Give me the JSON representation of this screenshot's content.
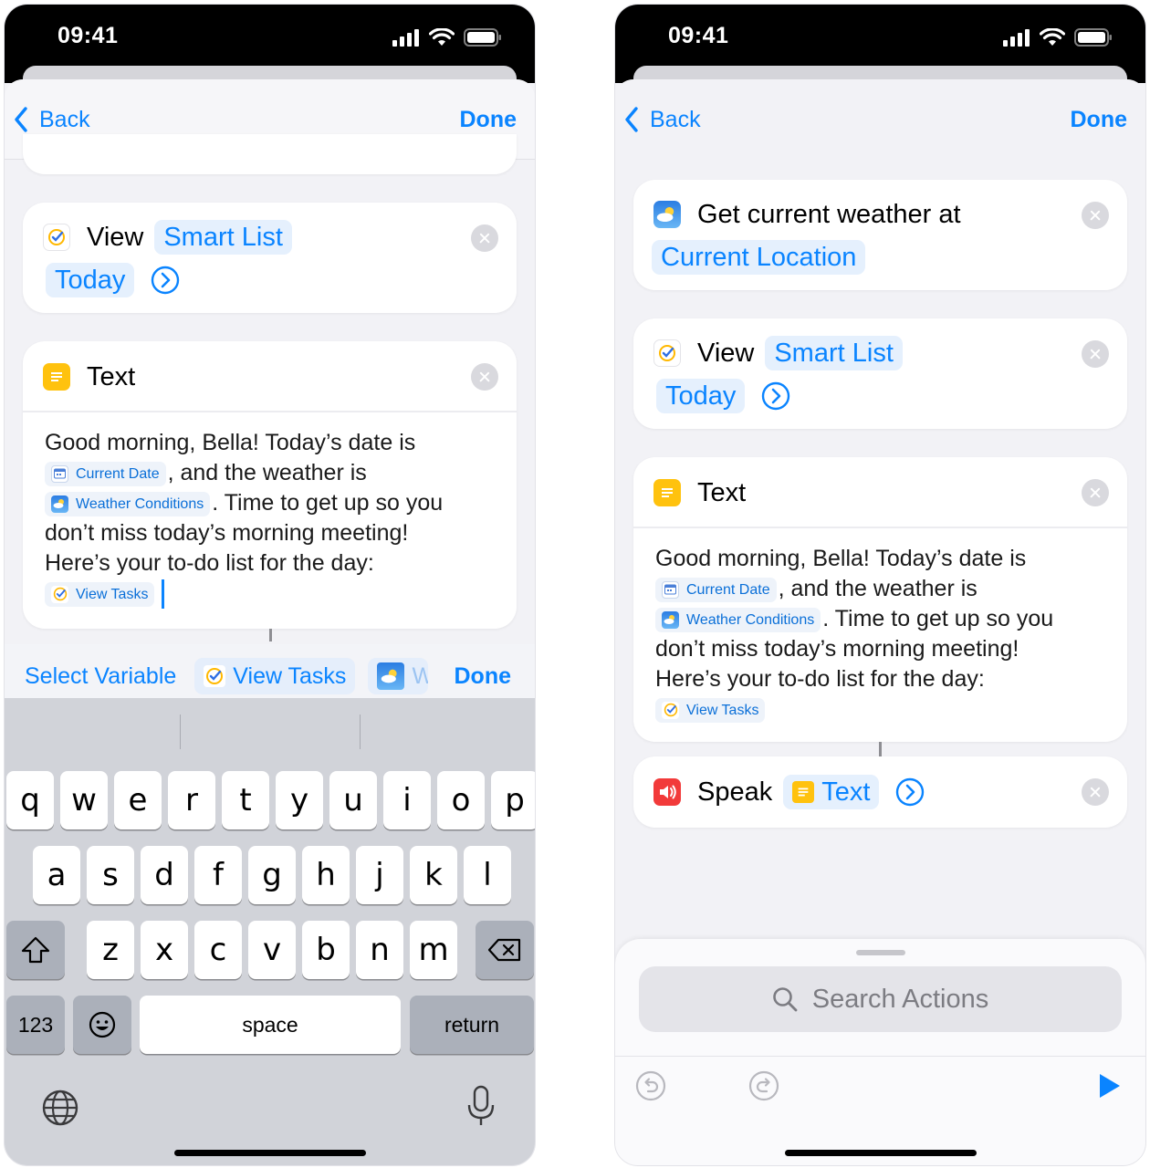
{
  "status": {
    "time": "09:41"
  },
  "nav": {
    "back_label": "Back",
    "done_label": "Done"
  },
  "left": {
    "view_action": {
      "verb": "View",
      "param": "Smart List",
      "value": "Today"
    },
    "text_action": {
      "title": "Text",
      "line1": "Good morning, Bella! Today’s date is",
      "token_date": "Current Date",
      "after_date": ", and the weather is",
      "token_weather": "Weather Conditions",
      "after_weather": ". Time to get up so you",
      "line4": "don’t miss today’s morning meeting!",
      "line5": "Here’s your to-do list for the day:",
      "token_tasks": "View Tasks"
    },
    "variable_bar": {
      "label": "Select Variable",
      "chip1": "View Tasks",
      "chip2_partial": "W",
      "done": "Done"
    },
    "keyboard": {
      "row1": [
        "q",
        "w",
        "e",
        "r",
        "t",
        "y",
        "u",
        "i",
        "o",
        "p"
      ],
      "row2": [
        "a",
        "s",
        "d",
        "f",
        "g",
        "h",
        "j",
        "k",
        "l"
      ],
      "row3": [
        "z",
        "x",
        "c",
        "v",
        "b",
        "n",
        "m"
      ],
      "numbers_key": "123",
      "space_key": "space",
      "return_key": "return"
    }
  },
  "right": {
    "weather_action": {
      "title": "Get current weather at",
      "param": "Current Location"
    },
    "view_action": {
      "verb": "View",
      "param": "Smart List",
      "value": "Today"
    },
    "text_action": {
      "title": "Text",
      "line1": "Good morning, Bella! Today’s date is",
      "token_date": "Current Date",
      "after_date": ", and the weather is",
      "token_weather": "Weather Conditions",
      "after_weather": ". Time to get up so you",
      "line4": "don’t miss today’s morning meeting!",
      "line5": "Here’s your to-do list for the day:",
      "token_tasks": "View Tasks"
    },
    "speak_action": {
      "verb": "Speak",
      "param": "Text"
    },
    "drawer": {
      "search_placeholder": "Search Actions"
    }
  },
  "colors": {
    "accent": "#0a84ff",
    "token_bg": "#e5f0fd",
    "text_icon": "#ffc20e",
    "speak_icon": "#f23a3a"
  },
  "icons": [
    "chevron-left-icon",
    "close-icon",
    "tasks-check-icon",
    "text-doc-icon",
    "weather-icon",
    "speaker-icon",
    "calendar-icon",
    "chevron-right-circle-icon",
    "shift-icon",
    "delete-icon",
    "emoji-icon",
    "globe-icon",
    "microphone-icon",
    "search-icon",
    "undo-icon",
    "redo-icon",
    "play-icon"
  ]
}
